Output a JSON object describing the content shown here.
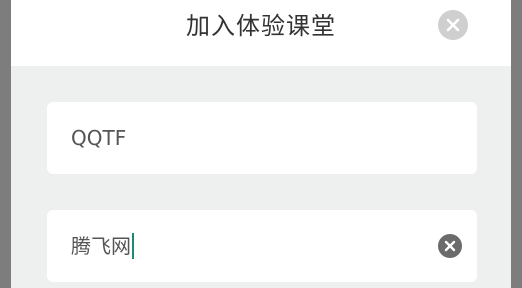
{
  "dialog": {
    "title": "加入体验课堂",
    "close_icon": "close-circle-icon"
  },
  "form": {
    "class_code_value": "QQTF",
    "name_value": "腾飞网",
    "clear_icon": "clear-circle-icon"
  }
}
